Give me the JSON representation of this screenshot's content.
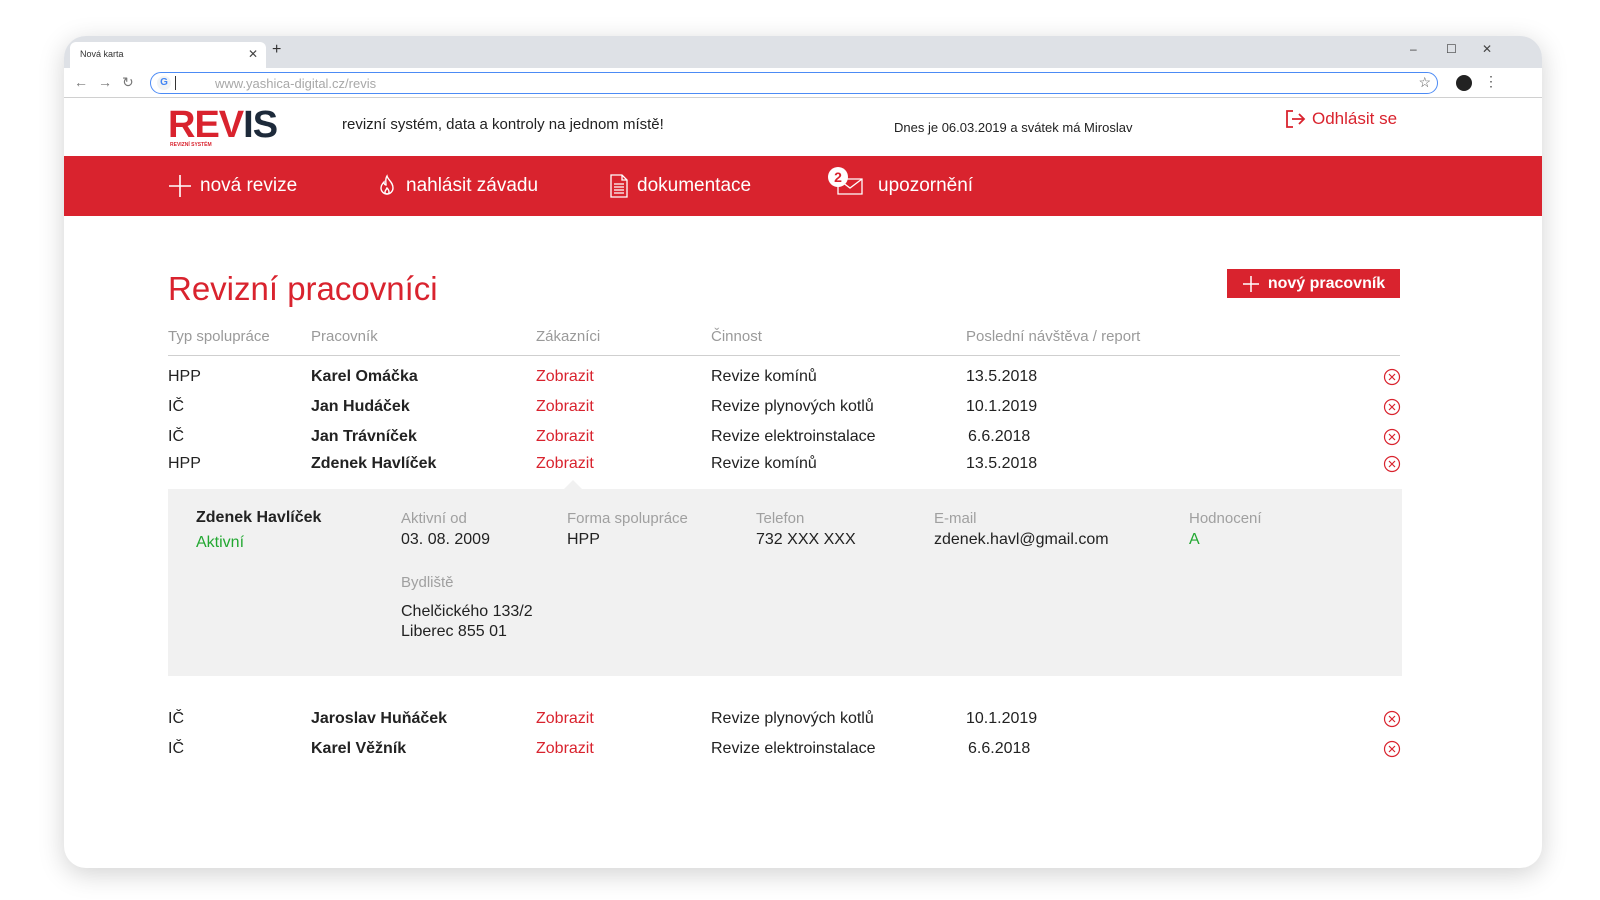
{
  "browser": {
    "tab_title": "Nová karta",
    "url": "www.yashica-digital.cz/revis"
  },
  "header": {
    "logo_red": "REV",
    "logo_dark": "IS",
    "logo_sub": "REVIZNÍ SYSTÉM",
    "tagline": "revizní systém, data a kontroly na jednom místě!",
    "today": "Dnes je 06.03.2019 a svátek má Miroslav",
    "logout": "Odhlásit se"
  },
  "nav": {
    "items": [
      {
        "label": "nová revize",
        "icon": "plus-icon"
      },
      {
        "label": "nahlásit závadu",
        "icon": "flame-icon"
      },
      {
        "label": "dokumentace",
        "icon": "document-icon"
      },
      {
        "label": "upozornění",
        "icon": "envelope-icon",
        "badge": "2"
      }
    ]
  },
  "page": {
    "title": "Revizní pracovníci",
    "add_button": "nový pracovník"
  },
  "table": {
    "columns": [
      "Typ spolupráce",
      "Pracovník",
      "Zákazníci",
      "Činnost",
      "Poslední návštěva / report"
    ],
    "rows": [
      {
        "type": "HPP",
        "name": "Karel Omáčka",
        "customers": "Zobrazit",
        "activity": "Revize komínů",
        "last": "13.5.2018"
      },
      {
        "type": "IČ",
        "name": "Jan Hudáček",
        "customers": "Zobrazit",
        "activity": "Revize plynových kotlů",
        "last": "10.1.2019"
      },
      {
        "type": "IČ",
        "name": "Jan Trávníček",
        "customers": "Zobrazit",
        "activity": "Revize elektroinstalace",
        "last": "6.6.2018"
      },
      {
        "type": "HPP",
        "name": "Zdenek Havlíček",
        "customers": "Zobrazit",
        "activity": "Revize komínů",
        "last": "13.5.2018"
      },
      {
        "type": "IČ",
        "name": "Jaroslav Huňáček",
        "customers": "Zobrazit",
        "activity": "Revize plynových kotlů",
        "last": "10.1.2019"
      },
      {
        "type": "IČ",
        "name": "Karel Věžník",
        "customers": "Zobrazit",
        "activity": "Revize elektroinstalace",
        "last": "6.6.2018"
      }
    ]
  },
  "detail": {
    "name": "Zdenek Havlíček",
    "status": "Aktivní",
    "active_from_label": "Aktivní od",
    "active_from": "03. 08. 2009",
    "form_label": "Forma spolupráce",
    "form": "HPP",
    "phone_label": "Telefon",
    "phone": "732 XXX XXX",
    "email_label": "E-mail",
    "email": "zdenek.havl@gmail.com",
    "rating_label": "Hodnocení",
    "rating": "A",
    "address_label": "Bydliště",
    "address_line1": "Chelčického 133/2",
    "address_line2": "Liberec 855 01"
  },
  "colors": {
    "brand_red": "#d9232e",
    "brand_dark": "#1d2a3a",
    "active_green": "#22a831"
  }
}
